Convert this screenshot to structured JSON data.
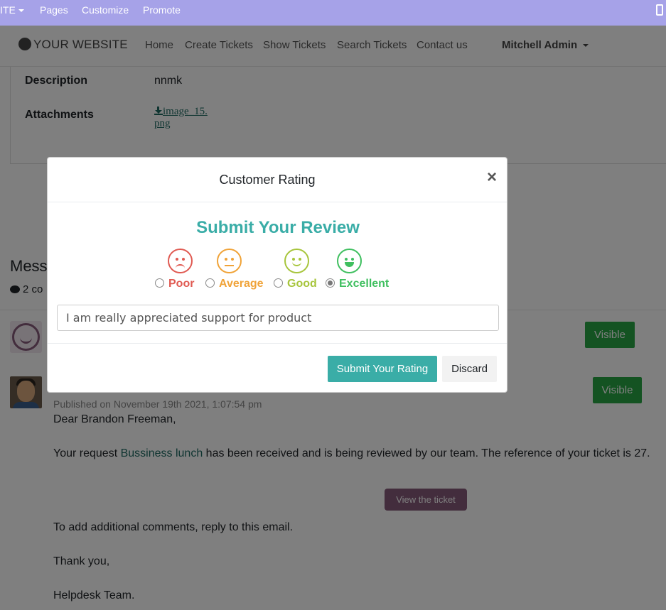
{
  "admin_bar": {
    "site_menu": "ITE",
    "pages": "Pages",
    "customize": "Customize",
    "promote": "Promote"
  },
  "nav": {
    "brand": "YOUR WEBSITE",
    "links": [
      "Home",
      "Create Tickets",
      "Show Tickets",
      "Search Tickets",
      "Contact us"
    ],
    "user": "Mitchell Admin"
  },
  "ticket": {
    "description_label": "Description",
    "description_value": "nnmk",
    "attachments_label": "Attachments",
    "attachment_name_line1": "image_15.",
    "attachment_name_line2": "png"
  },
  "messages": {
    "heading": "Messa",
    "count_text": "2 co",
    "visible_label": "Visible",
    "published": "Published on November 19th 2021, 1:07:54 pm",
    "greeting": "Dear Brandon Freeman,",
    "request_prefix": "Your request ",
    "request_link": "Bussiness lunch",
    "request_suffix": " has been received and is being reviewed by our team. The reference of your ticket is 27.",
    "view_ticket": "View the ticket",
    "add_comments": "To add additional comments, reply to this email.",
    "thanks": "Thank you,",
    "signature": "Helpdesk Team."
  },
  "modal": {
    "title": "Customer Rating",
    "close": "×",
    "review_title": "Submit Your Review",
    "options": [
      {
        "label": "Poor",
        "color": "#e05a52",
        "checked": false
      },
      {
        "label": "Average",
        "color": "#f0a338",
        "checked": false
      },
      {
        "label": "Good",
        "color": "#a7c53c",
        "checked": false
      },
      {
        "label": "Excellent",
        "color": "#3fbf5f",
        "checked": true
      }
    ],
    "review_text": "I am really appreciated support for product",
    "submit": "Submit Your Rating",
    "discard": "Discard"
  },
  "colors": {
    "admin_bar": "#a6a2e8",
    "accent": "#3aada7",
    "visible_button": "#28a745",
    "view_ticket": "#875a7b"
  }
}
